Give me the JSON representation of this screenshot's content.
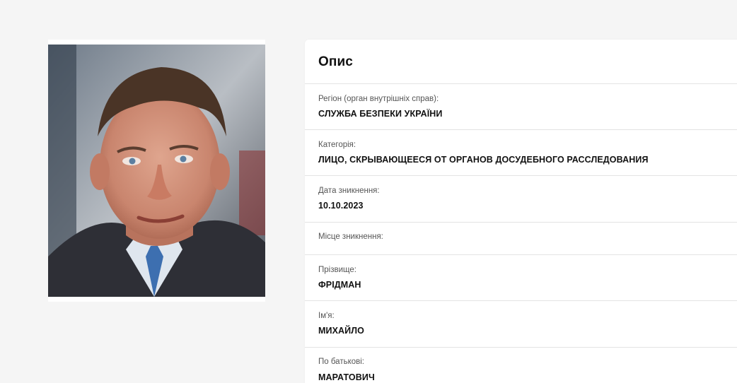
{
  "card": {
    "title": "Опис"
  },
  "fields": [
    {
      "label": "Регіон (орган внутрішніх справ):",
      "value": "СЛУЖБА БЕЗПЕКИ УКРАЇНИ"
    },
    {
      "label": "Категорія:",
      "value": "ЛИЦО, СКРЫВАЮЩЕЕСЯ ОТ ОРГАНОВ ДОСУДЕБНОГО РАССЛЕДОВАНИЯ"
    },
    {
      "label": "Дата зникнення:",
      "value": "10.10.2023"
    },
    {
      "label": "Місце зникнення:",
      "value": ""
    },
    {
      "label": "Прізвище:",
      "value": "ФРІДМАН"
    },
    {
      "label": "Ім'я:",
      "value": "МИХАЙЛО"
    },
    {
      "label": "По батькові:",
      "value": "МАРАТОВИЧ"
    }
  ],
  "photo": {
    "description_icon": "person-photo"
  },
  "colors": {
    "background": "#f5f5f5",
    "card": "#ffffff",
    "divider": "#e3e3e3",
    "label": "#555555",
    "value": "#111111"
  }
}
